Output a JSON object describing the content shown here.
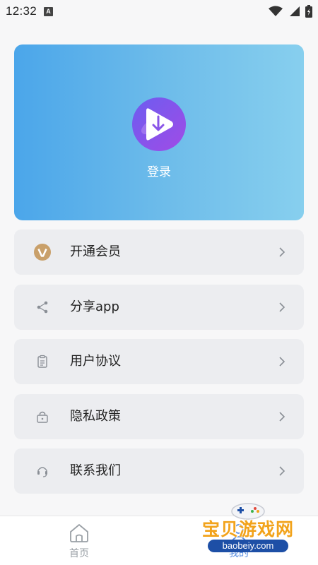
{
  "status_bar": {
    "time": "12:32",
    "notification_icon": "a-notification-icon",
    "wifi_icon": "wifi-icon",
    "battery_icon": "battery-icon"
  },
  "login_card": {
    "logo_icon": "download-play-logo",
    "login_label": "登录",
    "gradient": [
      "#4ba6ea",
      "#87cfee"
    ]
  },
  "menu": {
    "items": [
      {
        "label": "开通会员",
        "icon": "vip-icon"
      },
      {
        "label": "分享app",
        "icon": "share-icon"
      },
      {
        "label": "用户协议",
        "icon": "clipboard-icon"
      },
      {
        "label": "隐私政策",
        "icon": "lock-icon"
      },
      {
        "label": "联系我们",
        "icon": "headset-icon"
      }
    ]
  },
  "bottom_nav": {
    "items": [
      {
        "label": "首页",
        "icon": "home-icon"
      },
      {
        "label": "我的",
        "icon": "profile-icon"
      }
    ]
  },
  "watermark": {
    "title": "宝贝游戏网",
    "url": "baobeiy.com"
  },
  "colors": {
    "accent_purple": "#8a55e8",
    "vip_gold": "#c9a06a",
    "row_bg": "#ecedf0"
  }
}
